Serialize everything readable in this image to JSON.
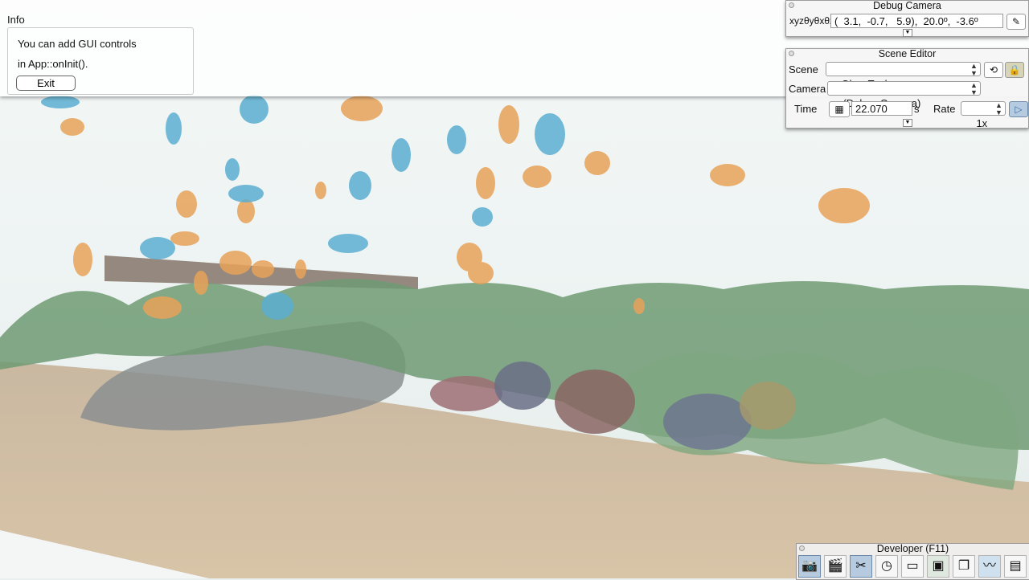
{
  "info": {
    "title": "Info",
    "line1": "You can add GUI controls",
    "line2": "in App::onInit().",
    "exit_label": "Exit"
  },
  "debug_camera": {
    "title": "Debug Camera",
    "xyz_label": "xyzθyθxθz",
    "value": "(  3.1,  -0.7,   5.9),  20.0º,  -3.6º",
    "icons": [
      "camera-edit-icon",
      "chevron-down-icon"
    ]
  },
  "scene_editor": {
    "title": "Scene Editor",
    "scene_label": "Scene",
    "scene_value": "GlassTank",
    "camera_label": "Camera",
    "camera_value": "(Debug Camera)",
    "time_label": "Time",
    "time_value": "22.070",
    "time_unit": "s",
    "rate_label": "Rate",
    "rate_value": "1x",
    "icons": [
      "reload-icon",
      "lock-icon",
      "clapper-icon",
      "play-icon",
      "chevron-down-icon"
    ]
  },
  "developer": {
    "title": "Developer (F11)",
    "tools": [
      "camera-icon",
      "film-icon",
      "tools-icon",
      "clock-icon",
      "note-icon",
      "console-icon",
      "window-icon",
      "profiler-icon",
      "document-icon"
    ]
  },
  "colors": {
    "accent": "#b7cbe0",
    "sand": "#cdb89d",
    "water": "#eef5f4",
    "fish_orange": "#e7a259",
    "fish_blue": "#5aaed0"
  }
}
